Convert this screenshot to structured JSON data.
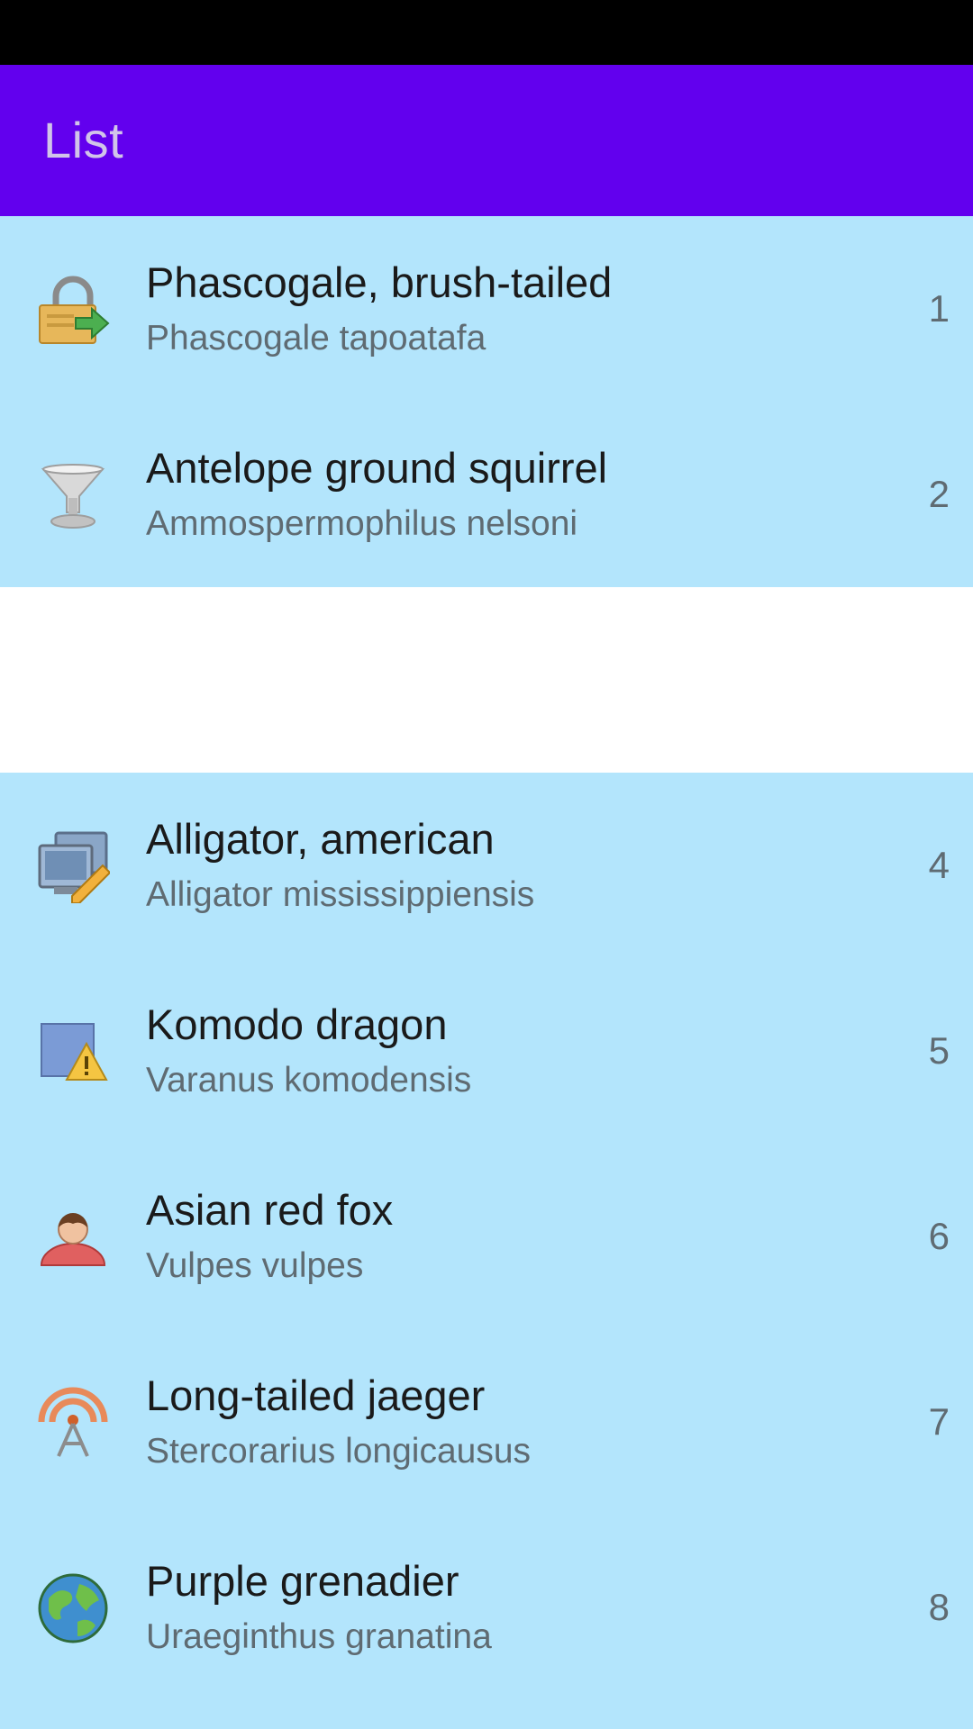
{
  "app_bar": {
    "title": "List"
  },
  "list": {
    "items": [
      {
        "title": "Phascogale, brush-tailed",
        "subtitle": "Phascogale tapoatafa",
        "number": "1",
        "icon": "lock-arrow-icon"
      },
      {
        "title": "Antelope ground squirrel",
        "subtitle": "Ammospermophilus nelsoni",
        "number": "2",
        "icon": "goblet-icon"
      },
      {
        "title": "Alligator, american",
        "subtitle": "Alligator mississippiensis",
        "number": "4",
        "icon": "monitor-edit-icon"
      },
      {
        "title": "Komodo dragon",
        "subtitle": "Varanus komodensis",
        "number": "5",
        "icon": "square-warning-icon"
      },
      {
        "title": "Asian red fox",
        "subtitle": "Vulpes vulpes",
        "number": "6",
        "icon": "user-icon"
      },
      {
        "title": "Long-tailed jaeger",
        "subtitle": "Stercorarius longicausus",
        "number": "7",
        "icon": "broadcast-tower-icon"
      },
      {
        "title": "Purple grenadier",
        "subtitle": "Uraeginthus granatina",
        "number": "8",
        "icon": "globe-icon"
      }
    ]
  },
  "colors": {
    "status_bar": "#000000",
    "app_bar": "#6200ee",
    "title_text": "#d1c4e9",
    "list_background": "#b3e5fc",
    "blank_row": "#ffffff"
  }
}
